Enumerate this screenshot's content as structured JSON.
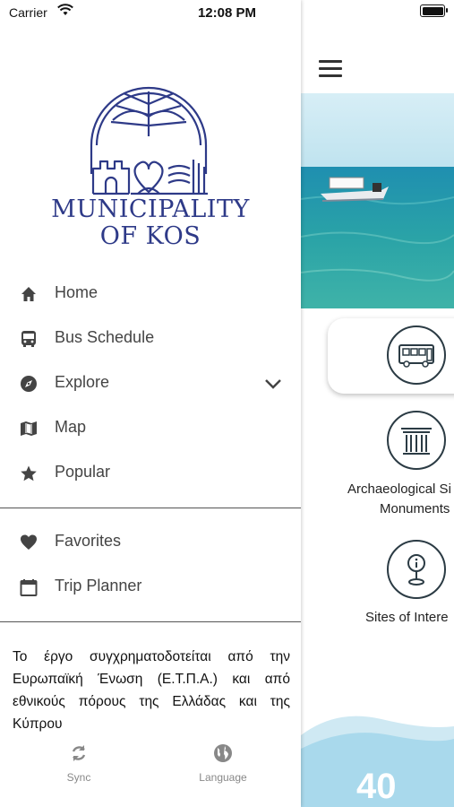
{
  "status_bar": {
    "carrier": "Carrier",
    "time": "12:08 PM"
  },
  "drawer": {
    "logo": {
      "line1": "MUNICIPALITY",
      "line2": "OF KOS"
    },
    "menu": [
      {
        "label": "Home",
        "icon": "home-icon"
      },
      {
        "label": "Bus Schedule",
        "icon": "bus-icon"
      },
      {
        "label": "Explore",
        "icon": "compass-icon"
      },
      {
        "label": "Map",
        "icon": "map-icon"
      },
      {
        "label": "Popular",
        "icon": "star-icon"
      }
    ],
    "secondary": [
      {
        "label": "Favorites",
        "icon": "heart-icon"
      },
      {
        "label": "Trip Planner",
        "icon": "calendar-icon"
      }
    ],
    "funding_text": "Το έργο συγχρηματοδοτείται από την Ευρωπαϊκή Ένωση (Ε.Τ.Π.Α.) και από εθνικούς πόρους της Ελλάδας και της Κύπρου",
    "footer": {
      "sync_label": "Sync",
      "language_label": "Language"
    }
  },
  "main": {
    "categories": [
      {
        "label_line1": "Archaeological Si",
        "label_line2": "Monuments"
      },
      {
        "label_line1": "Sites of Intere",
        "label_line2": ""
      }
    ],
    "counter": "40"
  },
  "colors": {
    "logo_blue": "#2e3a88",
    "icon_dark": "#2b3b44",
    "sea": "#2a9fa8",
    "wave": "#a9d9ec"
  }
}
